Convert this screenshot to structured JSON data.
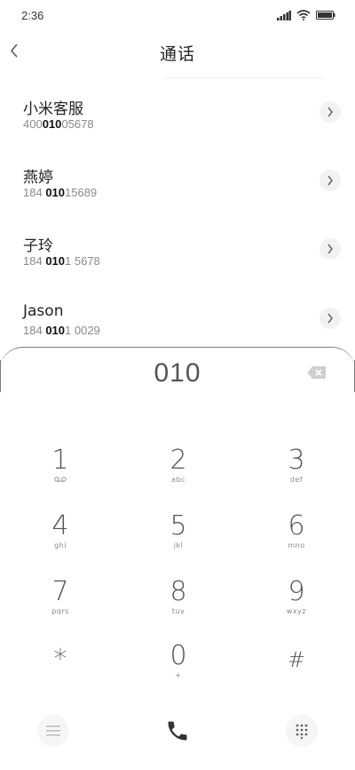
{
  "status_bar": {
    "time": "2:36",
    "icons": [
      "signal-icon",
      "wifi-icon",
      "battery-icon"
    ]
  },
  "nav": {
    "title": "通话",
    "back_icon": "chevron-left-icon"
  },
  "contacts": [
    {
      "name": "小米客服",
      "num_pre": "400",
      "num_match": "010",
      "num_post": "05678"
    },
    {
      "name": "燕婷",
      "num_pre": "184 ",
      "num_match": "010",
      "num_post": "15689"
    },
    {
      "name": "子玲",
      "num_pre": "184 ",
      "num_match": "010",
      "num_post": "1 5678"
    },
    {
      "name": "Jason",
      "num_pre": "184 ",
      "num_match": "010",
      "num_post": "1 0029"
    }
  ],
  "dialpad": {
    "entered": "010",
    "keys": [
      {
        "digit": "1",
        "letters": ""
      },
      {
        "digit": "2",
        "letters": "abc"
      },
      {
        "digit": "3",
        "letters": "def"
      },
      {
        "digit": "4",
        "letters": "ghi"
      },
      {
        "digit": "5",
        "letters": "jkl"
      },
      {
        "digit": "6",
        "letters": "mno"
      },
      {
        "digit": "7",
        "letters": "pqrs"
      },
      {
        "digit": "8",
        "letters": "tuv"
      },
      {
        "digit": "9",
        "letters": "wxyz"
      },
      {
        "digit": "*",
        "letters": ""
      },
      {
        "digit": "0",
        "letters": "+"
      },
      {
        "digit": "#",
        "letters": ""
      }
    ]
  },
  "colors": {
    "accent": "#333333",
    "muted": "#8a8a8a",
    "chevron_bg": "#f2f2f2"
  }
}
